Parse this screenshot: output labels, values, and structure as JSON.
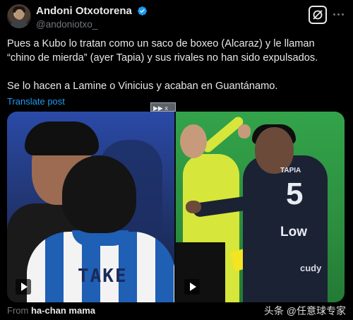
{
  "author": {
    "display_name": "Andoni Otxotorena",
    "handle": "@andoniotxo_",
    "verified": true
  },
  "tweet": {
    "paragraphs": [
      "Pues a Kubo lo tratan como un saco de boxeo (Alcaraz) y le llaman “chino de mierda” (ayer Tapia) y sus rivales no han sido expulsados.",
      "Se lo hacen a Lamine o Vinicius y acaban en Guantánamo."
    ],
    "translate_label": "Translate post"
  },
  "media": {
    "left_shirt_text": "TAKE",
    "right_shirt_name": "TAPIA",
    "right_shirt_number": "5",
    "right_sponsor": "Low",
    "right_sleeve_text": "cudy",
    "ad_badge": "▶▶ x"
  },
  "source": {
    "prefix": "From",
    "name": "ha-chan mama"
  },
  "watermark": "头条 @任意球专家",
  "icons": {
    "verified": "verified-badge-icon",
    "grok": "grok-icon",
    "more": "more-icon",
    "play": "play-icon"
  },
  "colors": {
    "accent": "#1d9bf0",
    "text": "#e7e9ea",
    "muted": "#71767b",
    "background": "#000000"
  }
}
